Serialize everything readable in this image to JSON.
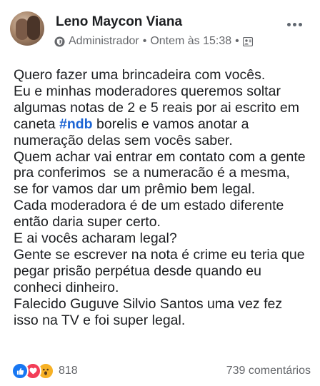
{
  "post": {
    "author_name": "Leno Maycon Viana",
    "author_role": "Administrador",
    "separator": "•",
    "timestamp": "Ontem às 15:38",
    "lines": [
      [
        "Quero fazer uma brincadeira com vocês."
      ],
      [
        "Eu e minhas moderadores queremos soltar"
      ],
      [
        "algumas notas de 2 e 5 reais por ai escrito em"
      ],
      [
        "caneta ",
        "#ndb",
        " borelis e vamos anotar a"
      ],
      [
        "numeração delas sem vocês saber."
      ],
      [
        "Quem achar vai entrar em contato com a gente"
      ],
      [
        "pra conferimos  se a numeracão é a mesma,"
      ],
      [
        "se for vamos dar um prêmio bem legal."
      ],
      [
        "Cada moderadora é de um estado diferente"
      ],
      [
        "então daria super certo."
      ],
      [
        "E ai vocês acharam legal?"
      ],
      [
        "Gente se escrever na nota é crime eu teria que"
      ],
      [
        "pegar prisão perpétua desde quando eu"
      ],
      [
        "conheci dinheiro."
      ],
      [
        "Falecido Guguve Silvio Santos uma vez fez"
      ],
      [
        "isso na TV e foi super legal."
      ]
    ],
    "reaction_count": "818",
    "comments_label": "739 comentários"
  },
  "icons": {
    "header_right": "more-options-icon",
    "role_badge": "admin-badge-icon",
    "audience": "group-audience-icon",
    "reactions": [
      "like-reaction-icon",
      "love-reaction-icon",
      "wow-reaction-icon"
    ]
  },
  "colors": {
    "hashtag": "#1b64d4",
    "like": "#1877f2",
    "love": "#f33e58",
    "wow": "#f7b125",
    "secondary_text": "#65676b"
  }
}
